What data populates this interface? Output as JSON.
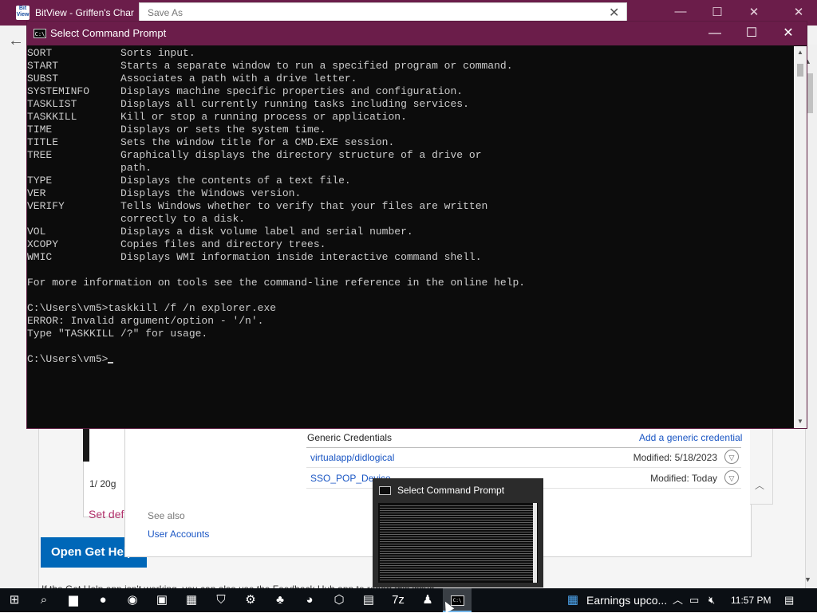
{
  "browser": {
    "title": "BitView - Griffen's Char",
    "logo_text": "Bit\nView",
    "controls": {
      "minimize": "—",
      "maximize": "☐",
      "close": "✕"
    },
    "back_icon": "arrow-left-icon",
    "saveas_title": "Save As"
  },
  "control_panel": {
    "date_fragment": "1/ 20g",
    "set_default": "Set def",
    "open_get_help": "Open Get Help",
    "generic_credentials_heading": "Generic Credentials",
    "add_generic_credential": "Add a generic credential",
    "credentials": [
      {
        "name": "virtualapp/didlogical",
        "modified": "Modified:  5/18/2023"
      },
      {
        "name": "SSO_POP_Device",
        "modified": "Modified:  Today"
      }
    ],
    "see_also": "See also",
    "user_accounts": "User Accounts",
    "bottom_text": "If the Get Help app isn't working, you can also use the Feedback Hub app to report this issue."
  },
  "cmd": {
    "title": "Select Command Prompt",
    "icon_text": "C:\\",
    "lines": [
      "SORT           Sorts input.",
      "START          Starts a separate window to run a specified program or command.",
      "SUBST          Associates a path with a drive letter.",
      "SYSTEMINFO     Displays machine specific properties and configuration.",
      "TASKLIST       Displays all currently running tasks including services.",
      "TASKKILL       Kill or stop a running process or application.",
      "TIME           Displays or sets the system time.",
      "TITLE          Sets the window title for a CMD.EXE session.",
      "TREE           Graphically displays the directory structure of a drive or",
      "               path.",
      "TYPE           Displays the contents of a text file.",
      "VER            Displays the Windows version.",
      "VERIFY         Tells Windows whether to verify that your files are written",
      "               correctly to a disk.",
      "VOL            Displays a disk volume label and serial number.",
      "XCOPY          Copies files and directory trees.",
      "WMIC           Displays WMI information inside interactive command shell.",
      "",
      "For more information on tools see the command-line reference in the online help.",
      "",
      "C:\\Users\\vm5>taskkill /f /n explorer.exe",
      "ERROR: Invalid argument/option - '/n'.",
      "Type \"TASKKILL /?\" for usage.",
      ""
    ],
    "prompt": "C:\\Users\\vm5>"
  },
  "thumbnail": {
    "title": "Select Command Prompt"
  },
  "taskbar": {
    "icons": [
      {
        "name": "start-icon",
        "glyph": "⊞"
      },
      {
        "name": "search-icon",
        "glyph": "⌕"
      },
      {
        "name": "file-explorer-icon",
        "glyph": "▆"
      },
      {
        "name": "firefox-icon",
        "glyph": "●"
      },
      {
        "name": "chrome-icon",
        "glyph": "◉"
      },
      {
        "name": "outlook-icon",
        "glyph": "▣"
      },
      {
        "name": "store-icon",
        "glyph": "▦"
      },
      {
        "name": "defender-icon",
        "glyph": "⛉"
      },
      {
        "name": "settings-icon",
        "glyph": "⚙"
      },
      {
        "name": "app-icon",
        "glyph": "♣"
      },
      {
        "name": "edge-icon",
        "glyph": "◕"
      },
      {
        "name": "package-icon",
        "glyph": "⬡"
      },
      {
        "name": "shopping-bag-icon",
        "glyph": "▤"
      },
      {
        "name": "7zip-icon",
        "glyph": "7z"
      },
      {
        "name": "users-icon",
        "glyph": "♟"
      }
    ],
    "active_app": "command-prompt-icon",
    "news_widget": "Earnings upco...",
    "clock": "11:57 PM"
  }
}
